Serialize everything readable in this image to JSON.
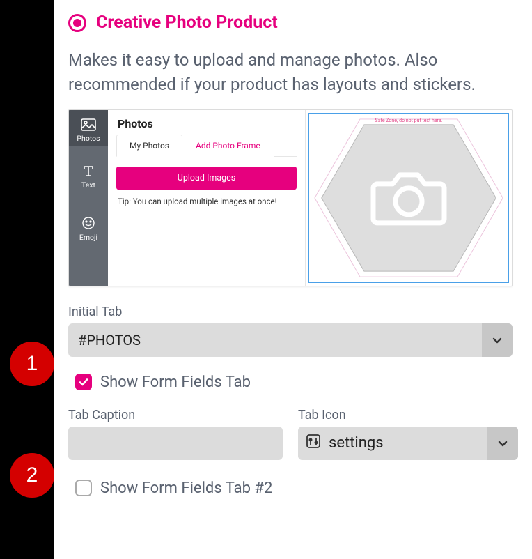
{
  "header": {
    "title": "Creative Photo Product",
    "description": "Makes it easy to upload and manage photos. Also recommended if your product has layouts and stickers."
  },
  "preview": {
    "sidebar": {
      "photos": "Photos",
      "text": "Text",
      "emoji": "Emoji"
    },
    "panel": {
      "title": "Photos",
      "tab_my_photos": "My Photos",
      "tab_add_frame": "Add Photo Frame",
      "upload_button": "Upload Images",
      "tip": "Tip: You can upload multiple images at once!"
    },
    "canvas": {
      "safe_zone": "Safe Zone, do not put text here."
    }
  },
  "form": {
    "initial_tab_label": "Initial Tab",
    "initial_tab_value": "#PHOTOS",
    "show_form_fields_label": "Show Form Fields Tab",
    "tab_caption_label": "Tab Caption",
    "tab_caption_value": "",
    "tab_icon_label": "Tab Icon",
    "tab_icon_value": "settings",
    "show_form_fields_2_label": "Show Form Fields Tab #2"
  },
  "markers": {
    "one": "1",
    "two": "2"
  }
}
